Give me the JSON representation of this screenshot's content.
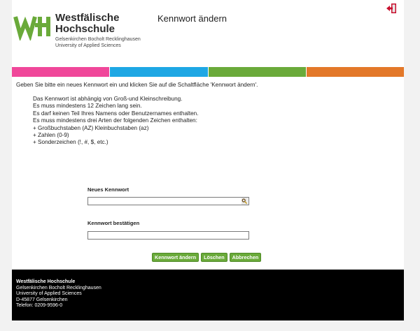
{
  "header": {
    "logo_name_1": "Westfälische",
    "logo_name_2": "Hochschule",
    "logo_sub_1": "Gelsenkirchen Bocholt Recklinghausen",
    "logo_sub_2": "University of Applied Sciences",
    "title": "Kennwort ändern",
    "logout_icon": "logout-icon"
  },
  "colors": {
    "bars": [
      "#f0479a",
      "#1ea7e4",
      "#6aaa3a",
      "#e37829"
    ],
    "logo_green": "#6aaa3a",
    "button_green": "#6aaa3a",
    "footer_bg": "#000000"
  },
  "instructions": {
    "intro": "Geben Sie bitte ein neues Kennwort ein und klicken Sie auf die Schaltfläche 'Kennwort ändern'.",
    "rules": [
      "Das Kennwort ist abhängig von Groß-und Kleinschreibung.",
      "Es muss mindestens 12 Zeichen lang sein.",
      "Es darf keinen Teil Ihres Namens oder Benutzernames enthalten.",
      "Es muss mindestens drei Arten der folgenden Zeichen enthalten:",
      "+ Großbuchstaben (AZ) Kleinbuchstaben (az)",
      "+ Zahlen (0-9)",
      "+ Sonderzeichen (!, #, $, etc.)"
    ]
  },
  "form": {
    "new_password_label": "Neues Kennwort",
    "new_password_value": "",
    "confirm_password_label": "Kennwort bestätigen",
    "confirm_password_value": "",
    "buttons": {
      "change": "Kennwort ändern",
      "clear": "Löschen",
      "cancel": "Abbrechen"
    }
  },
  "footer": {
    "lines": [
      "Westfälische Hochschule",
      "Gelsenkirchen Bocholt Recklinghausen",
      "University of Applied Sciences",
      "D-45877 Gelsenkirchen",
      "Telefon: 0209-9596-0"
    ]
  }
}
